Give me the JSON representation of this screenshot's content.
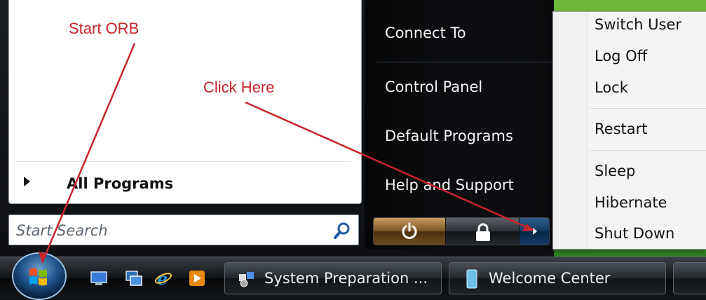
{
  "start_menu": {
    "all_programs_label": "All Programs",
    "search_placeholder": "Start Search",
    "right_items": [
      "Connect To",
      "Control Panel",
      "Default Programs",
      "Help and Support"
    ]
  },
  "power_submenu": {
    "items": [
      "Switch User",
      "Log Off",
      "Lock",
      "Restart",
      "Sleep",
      "Hibernate",
      "Shut Down"
    ]
  },
  "taskbar": {
    "buttons": [
      {
        "label": "System Preparation ...",
        "icon": "sysprep-icon"
      },
      {
        "label": "Welcome Center",
        "icon": "welcome-center-icon"
      }
    ],
    "quick_launch": [
      "show-desktop-icon",
      "switch-windows-icon",
      "internet-explorer-icon",
      "media-player-icon"
    ]
  },
  "annotations": {
    "start_orb": "Start ORB",
    "click_here": "Click Here",
    "color": "#c8242c"
  },
  "colors": {
    "power_button": "#7b5424",
    "arrow_button": "#123a63",
    "desktop": "#4a9a2e"
  }
}
